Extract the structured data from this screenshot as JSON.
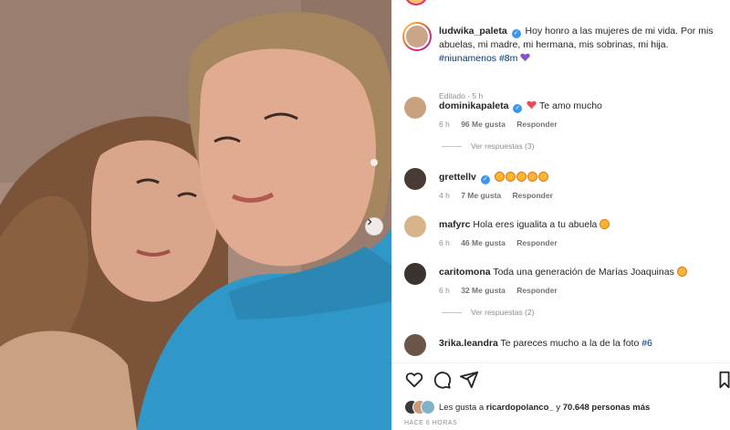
{
  "post": {
    "author": "ludwika_paleta",
    "caption": "Hoy honro a las mujeres de mi vida. Por mis abuelas, mi madre, mi hermana, mis sobrinas, mi hija.",
    "hashtags": "#niunamenos #8m",
    "edited_label": "Editado",
    "edited_time": "5 h",
    "likes_prefix": "Les gusta a",
    "likes_user": "ricardopolanco_",
    "likes_connector": "y",
    "likes_count": "70.648 personas más",
    "time_ago": "HACE 6 HORAS"
  },
  "comments": [
    {
      "user": "dominikapaleta",
      "verified": true,
      "text": "Te amo mucho",
      "time": "6 h",
      "likes": "96 Me gusta",
      "reply": "Responder",
      "view_replies": "Ver respuestas (3)",
      "avatar_color": "#c8a27e"
    },
    {
      "user": "grettellv",
      "verified": true,
      "text": "",
      "time": "4 h",
      "likes": "7 Me gusta",
      "reply": "Responder",
      "avatar_color": "#4a3a34"
    },
    {
      "user": "mafyrc",
      "verified": false,
      "text": "Hola eres igualita a tu abuela",
      "time": "6 h",
      "likes": "46 Me gusta",
      "reply": "Responder",
      "avatar_color": "#d8b48a"
    },
    {
      "user": "caritomona",
      "verified": false,
      "text": "Toda una generación de Marías Joaquinas",
      "time": "6 h",
      "likes": "32 Me gusta",
      "reply": "Responder",
      "view_replies": "Ver respuestas (2)",
      "avatar_color": "#3a3330"
    },
    {
      "user": "3rika.leandra",
      "verified": false,
      "text": "Te pareces mucho a la de la foto",
      "tag": "#6",
      "avatar_color": "#6a5548"
    }
  ],
  "icons": {
    "like": "heart-icon",
    "comment": "comment-icon",
    "share": "share-icon",
    "save": "bookmark-icon",
    "next": "chevron-right-icon"
  },
  "colors": {
    "link": "#00376b",
    "verified": "#3897f0",
    "muted": "#8e8e8e",
    "heart_red": "#ed4956"
  }
}
